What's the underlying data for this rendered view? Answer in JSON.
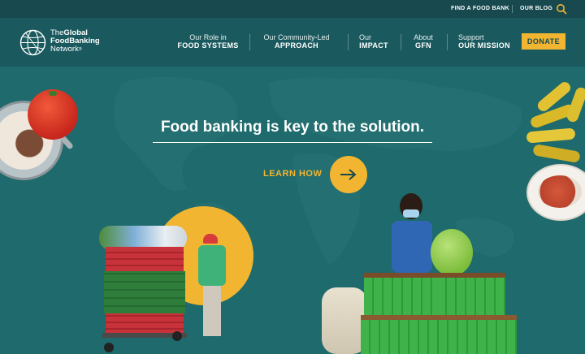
{
  "utility": {
    "find_food_bank": "FIND A FOOD BANK",
    "blog": "OUR BLOG",
    "search_icon": "search-icon"
  },
  "logo": {
    "line1a": "The",
    "line1b": "Global",
    "line2": "FoodBanking",
    "line3": "Network",
    "reg": "®"
  },
  "nav": {
    "items": [
      {
        "line1": "Our Role in",
        "line2": "FOOD SYSTEMS"
      },
      {
        "line1": "Our Community-Led",
        "line2": "APPROACH"
      },
      {
        "line1": "Our",
        "line2": "IMPACT"
      },
      {
        "line1": "About",
        "line2": "GFN"
      },
      {
        "line1": "Support",
        "line2": "OUR MISSION"
      }
    ],
    "donate": "DONATE"
  },
  "hero": {
    "headline": "Food banking is key to the solution.",
    "cta": "LEARN HOW",
    "cta_icon": "arrow-right-icon"
  },
  "colors": {
    "topbar": "#17494f",
    "nav": "#1a5a5f",
    "hero": "#1e6a6c",
    "accent": "#f2b531",
    "crate_green": "#3fb24a",
    "crate_red": "#c8323a"
  }
}
